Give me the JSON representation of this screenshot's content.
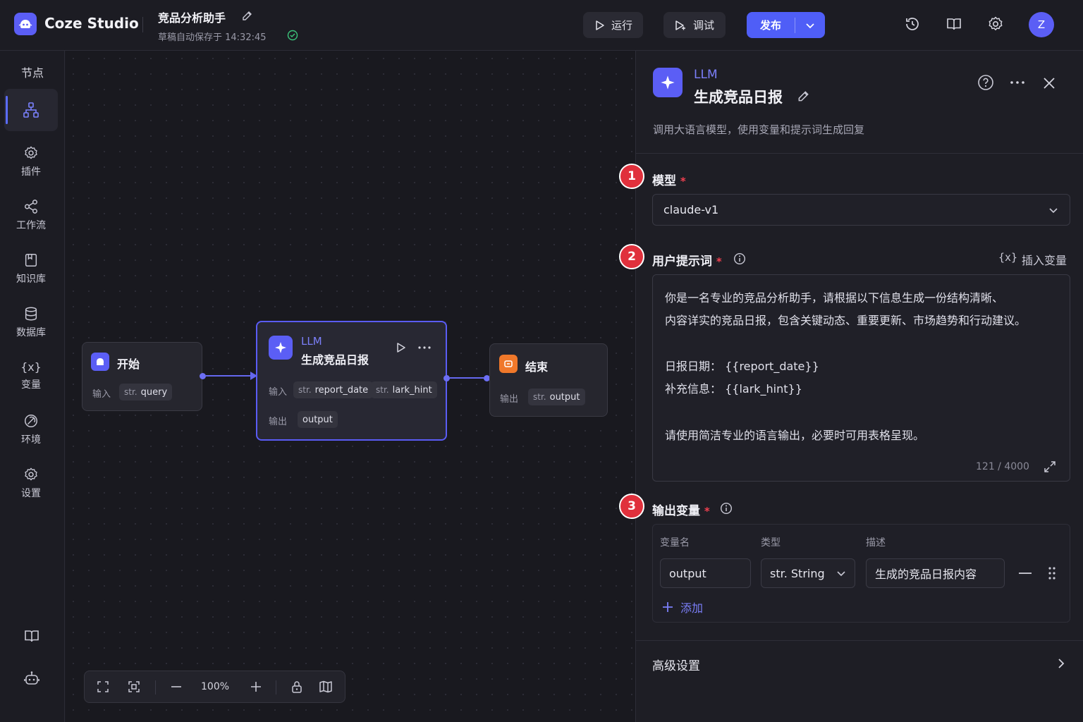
{
  "app": {
    "brand": "Coze Studio",
    "project_title": "竞品分析助手",
    "saved_status": "草稿自动保存于 14:32:45"
  },
  "toolbar": {
    "run_label": "运行",
    "debug_label": "调试",
    "publish_label": "发布",
    "avatar_initial": "Z"
  },
  "sidebar": {
    "header": "节点",
    "items": [
      {
        "label": "",
        "icon": "node-tree-icon"
      },
      {
        "label": "插件",
        "icon": "plugin-gear-icon"
      },
      {
        "label": "工作流",
        "icon": "share-nodes-icon"
      },
      {
        "label": "知识库",
        "icon": "knowledge-icon"
      },
      {
        "label": "数据库",
        "icon": "database-icon"
      },
      {
        "label": "变量",
        "icon": "variable-icon"
      },
      {
        "label": "环境",
        "icon": "environment-icon"
      },
      {
        "label": "设置",
        "icon": "settings-icon"
      }
    ]
  },
  "canvas": {
    "start_node": {
      "title": "开始",
      "input_label": "输入",
      "input_type": "str.",
      "input_name": "query"
    },
    "llm_node": {
      "type": "LLM",
      "title": "生成竞品日报",
      "input_label": "输入",
      "inputs": [
        {
          "type": "str.",
          "name": "report_date"
        },
        {
          "type": "str.",
          "name": "lark_hint"
        }
      ],
      "output_label": "输出",
      "output_name": "output"
    },
    "end_node": {
      "title": "结束",
      "output_label": "输出",
      "output_type": "str.",
      "output_name": "output"
    },
    "zoom_level": "100%"
  },
  "panel": {
    "node_type": "LLM",
    "node_title": "生成竞品日报",
    "description": "调用大语言模型，使用变量和提示词生成回复",
    "steps": [
      "1",
      "2",
      "3"
    ],
    "model": {
      "label": "模型",
      "required": "*",
      "value": "claude-v1"
    },
    "prompt": {
      "label": "用户提示词",
      "required": "*",
      "insert_label": "插入变量",
      "insert_icon_text": "{x}",
      "lines": [
        "你是一名专业的竞品分析助手，请根据以下信息生成一份结构清晰、",
        "内容详实的竞品日报，包含关键动态、重要更新、市场趋势和行动建议。",
        "日报日期：  {{report_date}}",
        "补充信息：  {{lark_hint}}",
        "请使用简洁专业的语言输出，必要时可用表格呈现。"
      ],
      "counter": "121 / 4000"
    },
    "output": {
      "label": "输出变量",
      "required": "*",
      "headers": {
        "name": "变量名",
        "type": "类型",
        "desc": "描述"
      },
      "row": {
        "name": "output",
        "type": "str. String",
        "desc": "生成的竞品日报内容"
      },
      "add_label": "添加"
    },
    "advanced_label": "高级设置"
  },
  "colors": {
    "accent": "#5b5ef5",
    "step_badge": "#e0303c",
    "canvas_bg": "#19191f"
  }
}
